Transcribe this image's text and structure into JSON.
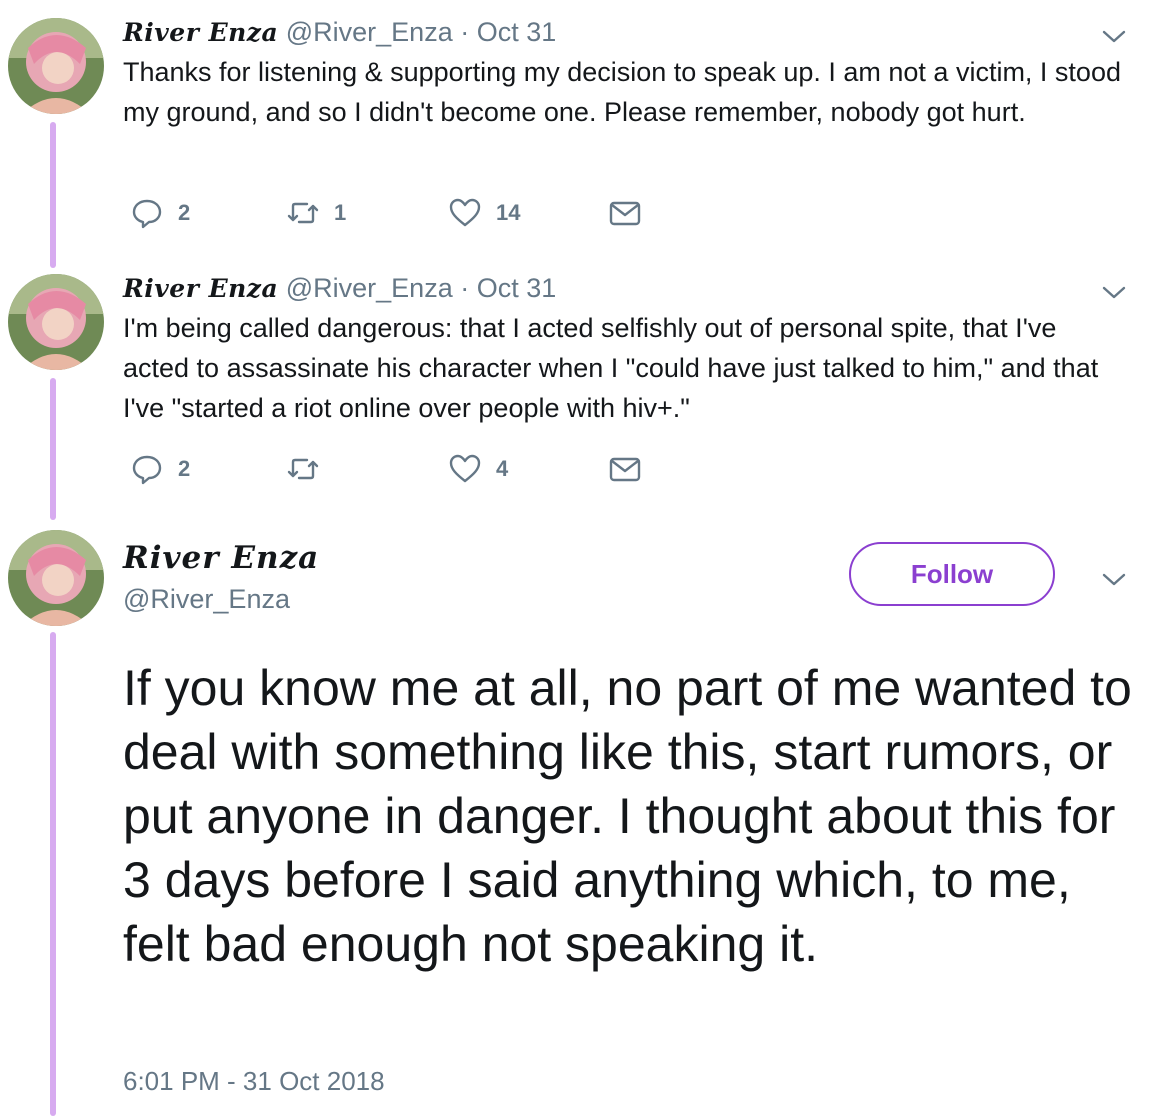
{
  "thread": [
    {
      "display_name": "River Enza",
      "handle": "@River_Enza",
      "separator": "·",
      "date": "Oct 31",
      "text": "Thanks for listening & supporting my decision to speak up. I am not a victim, I stood my ground, and so I didn't become one. Please remember, nobody got hurt.",
      "reply_count": "2",
      "retweet_count": "1",
      "like_count": "14"
    },
    {
      "display_name": "River Enza",
      "handle": "@River_Enza",
      "separator": "·",
      "date": "Oct 31",
      "text": "I'm being called dangerous: that I acted selfishly out of personal spite, that I've acted to assassinate his character when I \"could have just talked to him,\" and that I've \"started a riot online over people with hiv+.\"",
      "reply_count": "2",
      "retweet_count": "",
      "like_count": "4"
    }
  ],
  "main_tweet": {
    "display_name": "River Enza",
    "handle": "@River_Enza",
    "follow_label": "Follow",
    "text": "If you know me at all, no part of me wanted to deal with something like this, start rumors, or put anyone in danger. I thought about this for 3 days before I said anything which, to me, felt bad enough not speaking it.",
    "timestamp": "6:01 PM - 31 Oct 2018"
  },
  "colors": {
    "thread_line": "#d7abf0",
    "accent": "#8b3fd0",
    "muted_text": "#657786",
    "body_text": "#14171a"
  },
  "icons": {
    "reply": "reply-icon",
    "retweet": "retweet-icon",
    "like": "heart-icon",
    "message": "envelope-icon",
    "menu": "chevron-down-icon",
    "avatar": "avatar"
  }
}
